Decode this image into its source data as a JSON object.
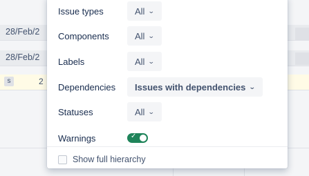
{
  "background": {
    "rows": [
      {
        "text": "28/Feb/2"
      },
      {
        "text": "28/Feb/2"
      },
      {
        "chip": "s",
        "text": "2"
      }
    ]
  },
  "filters": [
    {
      "label": "Issue types",
      "value": "All"
    },
    {
      "label": "Components",
      "value": "All"
    },
    {
      "label": "Labels",
      "value": "All"
    },
    {
      "label": "Dependencies",
      "value": "Issues with dependencies"
    },
    {
      "label": "Statuses",
      "value": "All"
    }
  ],
  "warnings": {
    "label": "Warnings",
    "enabled": true
  },
  "hierarchy": {
    "label": "Show full hierarchy",
    "checked": false
  },
  "colors": {
    "toggle_on": "#1f845a",
    "panel_bg": "#ffffff",
    "row_highlight": "#fffbe6"
  }
}
